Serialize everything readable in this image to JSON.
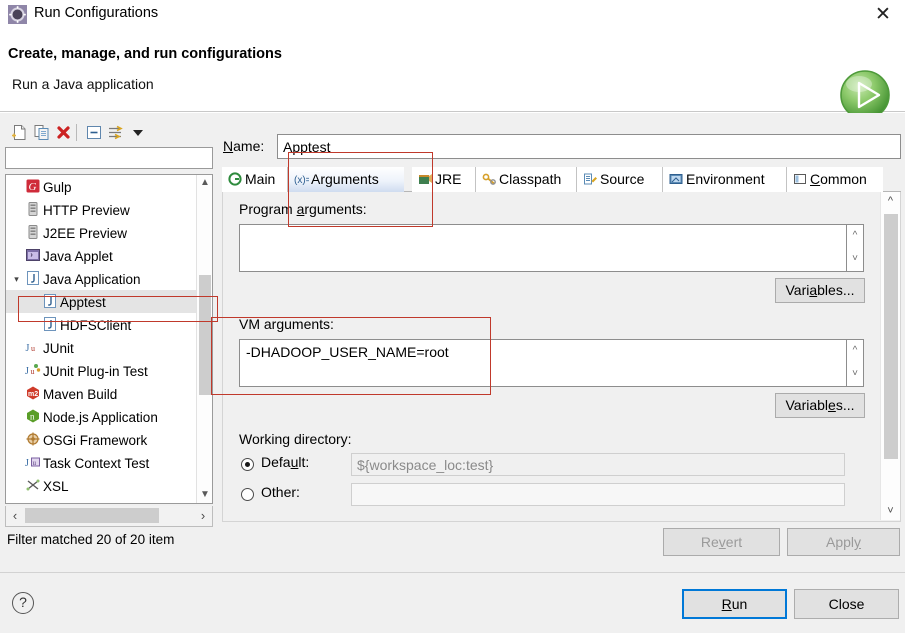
{
  "window": {
    "title": "Run Configurations",
    "icon": "gear-icon",
    "close_label": "✕"
  },
  "header": {
    "title": "Create, manage, and run configurations",
    "subtitle": "Run a Java application",
    "run_icon": "green-play-circle-icon"
  },
  "sidebar": {
    "toolbar": [
      {
        "name": "new-configuration-icon",
        "label": "New launch configuration"
      },
      {
        "name": "duplicate-configuration-icon",
        "label": "Duplicate"
      },
      {
        "name": "delete-configuration-icon",
        "label": "Delete"
      },
      {
        "name": "collapse-all-icon",
        "label": "Collapse All"
      },
      {
        "name": "filter-icon",
        "label": "Filter launch configurations"
      },
      {
        "name": "view-menu-chevron-down-icon",
        "label": "View Menu"
      }
    ],
    "filter": {
      "value": "",
      "placeholder": ""
    },
    "tree": [
      {
        "label": "Gulp",
        "icon": "gulp-icon",
        "indent": 0,
        "twisty": "",
        "selected": false
      },
      {
        "label": "HTTP Preview",
        "icon": "server-icon",
        "indent": 0,
        "twisty": "",
        "selected": false
      },
      {
        "label": "J2EE Preview",
        "icon": "server-icon",
        "indent": 0,
        "twisty": "",
        "selected": false
      },
      {
        "label": "Java Applet",
        "icon": "java-applet-icon",
        "indent": 0,
        "twisty": "",
        "selected": false
      },
      {
        "label": "Java Application",
        "icon": "java-application-icon",
        "indent": 0,
        "twisty": "expanded",
        "selected": false
      },
      {
        "label": "Apptest",
        "icon": "java-application-icon",
        "indent": 1,
        "twisty": "",
        "selected": true
      },
      {
        "label": "HDFSClient",
        "icon": "java-application-icon",
        "indent": 1,
        "twisty": "",
        "selected": false
      },
      {
        "label": "JUnit",
        "icon": "junit-icon",
        "indent": 0,
        "twisty": "",
        "selected": false
      },
      {
        "label": "JUnit Plug-in Test",
        "icon": "junit-plugin-icon",
        "indent": 0,
        "twisty": "",
        "selected": false
      },
      {
        "label": "Maven Build",
        "icon": "maven-icon",
        "indent": 0,
        "twisty": "",
        "selected": false
      },
      {
        "label": "Node.js Application",
        "icon": "nodejs-icon",
        "indent": 0,
        "twisty": "",
        "selected": false
      },
      {
        "label": "OSGi Framework",
        "icon": "osgi-icon",
        "indent": 0,
        "twisty": "",
        "selected": false
      },
      {
        "label": "Task Context Test",
        "icon": "task-context-icon",
        "indent": 0,
        "twisty": "",
        "selected": false
      },
      {
        "label": "XSL",
        "icon": "xsl-icon",
        "indent": 0,
        "twisty": "",
        "selected": false
      }
    ],
    "status": "Filter matched 20 of 20 item"
  },
  "main": {
    "name_field": {
      "label": "Name:",
      "label_mnemonic": "N",
      "value": "Apptest"
    },
    "tabs": [
      {
        "label": "Main",
        "icon": "main-tab-icon",
        "active": false,
        "mnemonic": ""
      },
      {
        "label": "Arguments",
        "icon": "arguments-tab-icon",
        "active": true,
        "mnemonic": ""
      },
      {
        "label": "JRE",
        "icon": "jre-tab-icon",
        "active": false,
        "mnemonic": ""
      },
      {
        "label": "Classpath",
        "icon": "classpath-tab-icon",
        "active": false,
        "mnemonic": ""
      },
      {
        "label": "Source",
        "icon": "source-tab-icon",
        "active": false,
        "mnemonic": ""
      },
      {
        "label": "Environment",
        "icon": "environment-tab-icon",
        "active": false,
        "mnemonic": ""
      },
      {
        "label": "Common",
        "icon": "common-tab-icon",
        "active": false,
        "mnemonic": "C"
      }
    ],
    "program_arguments": {
      "label": "Program arguments:",
      "label_pre": "Program ",
      "label_mnemonic": "a",
      "label_post": "rguments:",
      "value": "",
      "variables_button": "Variables...",
      "variables_mnemonic": "a"
    },
    "vm_arguments": {
      "label": "VM arguments:",
      "value": "-DHADOOP_USER_NAME=root",
      "variables_button": "Variables...",
      "variables_mnemonic": "e"
    },
    "working_directory": {
      "label": "Working directory:",
      "default_label": "Default:",
      "default_mnemonic": "u",
      "default_value": "${workspace_loc:test}",
      "default_selected": true,
      "other_label": "Other:",
      "other_value": "",
      "other_selected": false
    },
    "revert_button": {
      "label": "Revert",
      "mnemonic": "v",
      "enabled": false
    },
    "apply_button": {
      "label": "Apply",
      "mnemonic": "y",
      "enabled": false
    }
  },
  "footer": {
    "help_icon": "question-mark-icon",
    "run_button": {
      "label": "Run",
      "mnemonic": "R",
      "focused": true
    },
    "close_button": {
      "label": "Close",
      "mnemonic": ""
    }
  },
  "colors": {
    "annotation_red": "#c0392b",
    "focus_blue": "#0078d7",
    "selection_gray": "#e4e4e4",
    "panel_gray": "#f0f0f0",
    "run_green": "#5fbb46"
  }
}
